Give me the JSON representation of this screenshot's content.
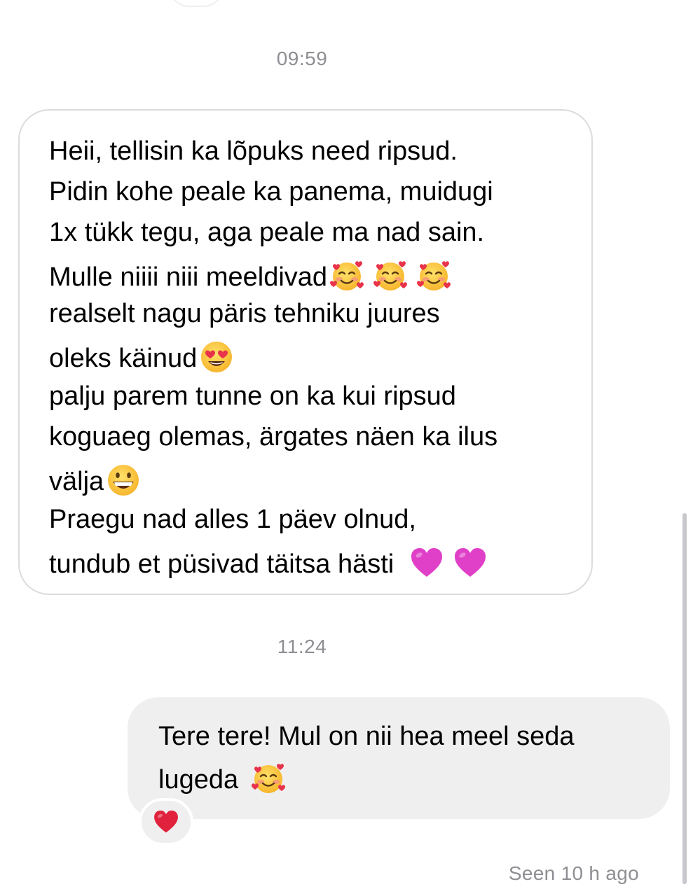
{
  "conversation": {
    "timestamp_1": "09:59",
    "timestamp_2": "11:24",
    "incoming_message": {
      "lines": [
        "Heii, tellisin ka lõpuks need ripsud.",
        "Pidin kohe peale ka panema, muidugi",
        "1x tükk tegu, aga peale ma nad sain.",
        "Mulle niiii niii meeldivad",
        "realselt nagu päris tehniku juures",
        "oleks käinud",
        "palju parem tunne on ka kui ripsud",
        "koguaeg olemas, ärgates näen ka ilus",
        "välja",
        "Praegu nad alles 1 päev olnud,",
        "tundub et püsivad täitsa hästi "
      ],
      "emojis": [
        "smiling-face-with-hearts",
        "smiling-face-with-hearts",
        "smiling-face-with-hearts",
        "heart-eyes",
        "grinning-face",
        "purple-heart",
        "purple-heart"
      ]
    },
    "outgoing_message": {
      "lines": [
        "Tere tere! Mul on nii hea meel seda",
        "lugeda "
      ],
      "emojis": [
        "smiling-face-with-hearts"
      ]
    },
    "reaction": "red-heart",
    "seen_status": "Seen 10 h ago"
  },
  "colors": {
    "incoming_border": "#dbdbdb",
    "outgoing_bg": "#efefef",
    "meta_text": "#8e8e93",
    "heart_red": "#e0245e",
    "purple_heart": "#e535c8"
  }
}
